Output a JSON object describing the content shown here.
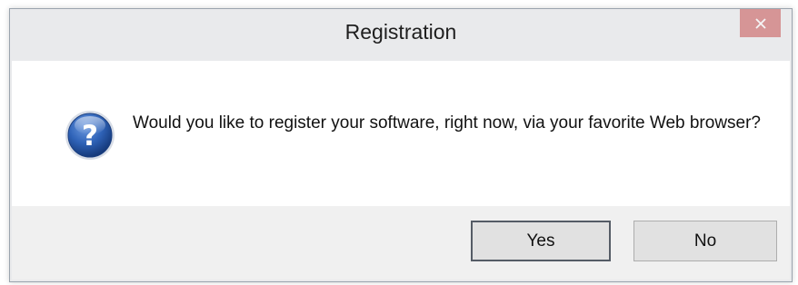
{
  "window": {
    "title": "Registration"
  },
  "dialog": {
    "icon": "question-icon",
    "message": "Would you like to register your software, right now, via your favorite Web browser?"
  },
  "buttons": {
    "yes_label": "Yes",
    "no_label": "No"
  },
  "colors": {
    "close_button": "#c75050",
    "icon_blue": "#2a5ba8",
    "titlebar": "#e9eaec",
    "footer": "#f0f0f0"
  }
}
